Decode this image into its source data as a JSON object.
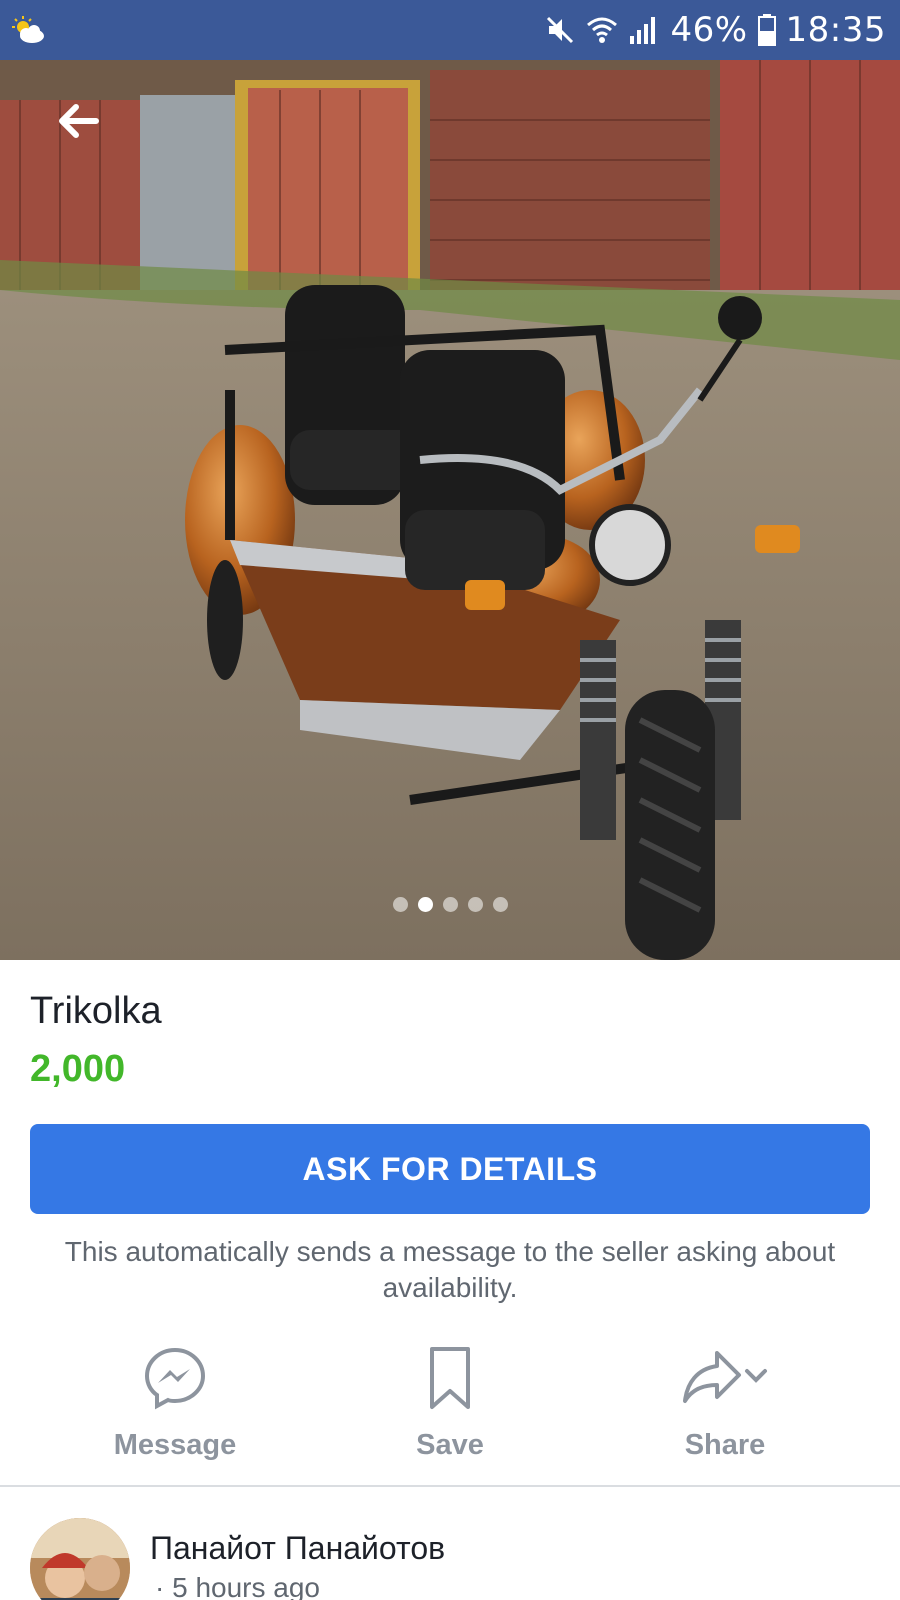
{
  "status_bar": {
    "weather_icon": "partly-cloudy-icon",
    "mute_icon": "mute-icon",
    "wifi_icon": "wifi-icon",
    "signal_icon": "signal-icon",
    "battery_percent": "46%",
    "battery_icon": "battery-icon",
    "time": "18:35",
    "background_color": "#3b5998"
  },
  "photo": {
    "back_icon": "arrow-left-icon",
    "carousel": {
      "count": 5,
      "active_index": 1
    }
  },
  "listing": {
    "title": "Trikolka",
    "price": "2,000",
    "price_color": "#42b72a"
  },
  "ask_button": {
    "label": "ASK FOR DETAILS",
    "color": "#3578e5"
  },
  "helper_text": "This automatically sends a message to the seller asking about availability.",
  "actions": [
    {
      "label": "Message",
      "icon": "messenger-icon"
    },
    {
      "label": "Save",
      "icon": "bookmark-icon"
    },
    {
      "label": "Share",
      "icon": "share-icon"
    }
  ],
  "seller": {
    "name": "Панайот Панайотов",
    "time": "· 5 hours ago"
  }
}
